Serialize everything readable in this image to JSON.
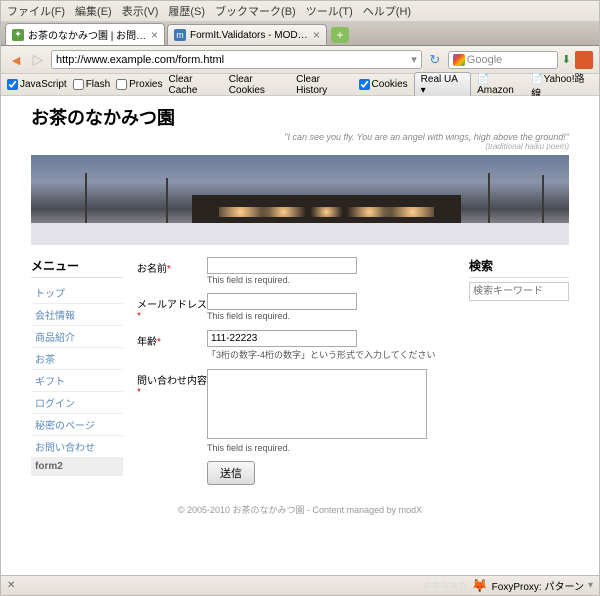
{
  "menubar": [
    "ファイル(F)",
    "編集(E)",
    "表示(V)",
    "履歴(S)",
    "ブックマーク(B)",
    "ツール(T)",
    "ヘルプ(H)"
  ],
  "tabs": [
    {
      "label": "お茶のなかみつ園 | お問い合..."
    },
    {
      "label": "FormIt.Validators - MODx A..."
    }
  ],
  "url": "http://www.example.com/form.html",
  "search_engine": "Google",
  "toolbar2": {
    "js": "JavaScript",
    "flash": "Flash",
    "proxies": "Proxies",
    "clear_cache": "Clear Cache",
    "clear_cookies": "Clear Cookies",
    "clear_history": "Clear History",
    "cookies": "Cookies",
    "ua": "Real UA",
    "amazon": "Amazon",
    "yahoo": "Yahoo!路線"
  },
  "site_title": "お茶のなかみつ園",
  "tagline": "\"I can see you fly. You are an angel with wings, high above the ground!\"",
  "tagline_sub": "(traditional haiku poem)",
  "sidebar_h": "メニュー",
  "menu": [
    "トップ",
    "会社情報",
    "商品紹介",
    "お茶",
    "ギフト",
    "ログイン",
    "秘密のページ",
    "お問い合わせ",
    "form2"
  ],
  "search_h": "検索",
  "search_ph": "検索キーワード",
  "form": {
    "name_label": "お名前",
    "name_err": "This field is required.",
    "email_label": "メールアドレス",
    "email_err": "This field is required.",
    "age_label": "年齢",
    "age_value": "111-22223",
    "age_hint": "「3桁の数字-4桁の数字」という形式で入力してください",
    "msg_label": "問い合わせ内容",
    "msg_err": "This field is required.",
    "submit": "送信"
  },
  "footer": "© 2005-2010 お茶のなかみつ園 - Content managed by modX",
  "statusbar": {
    "foxy": "FoxyProxy: パターン"
  }
}
